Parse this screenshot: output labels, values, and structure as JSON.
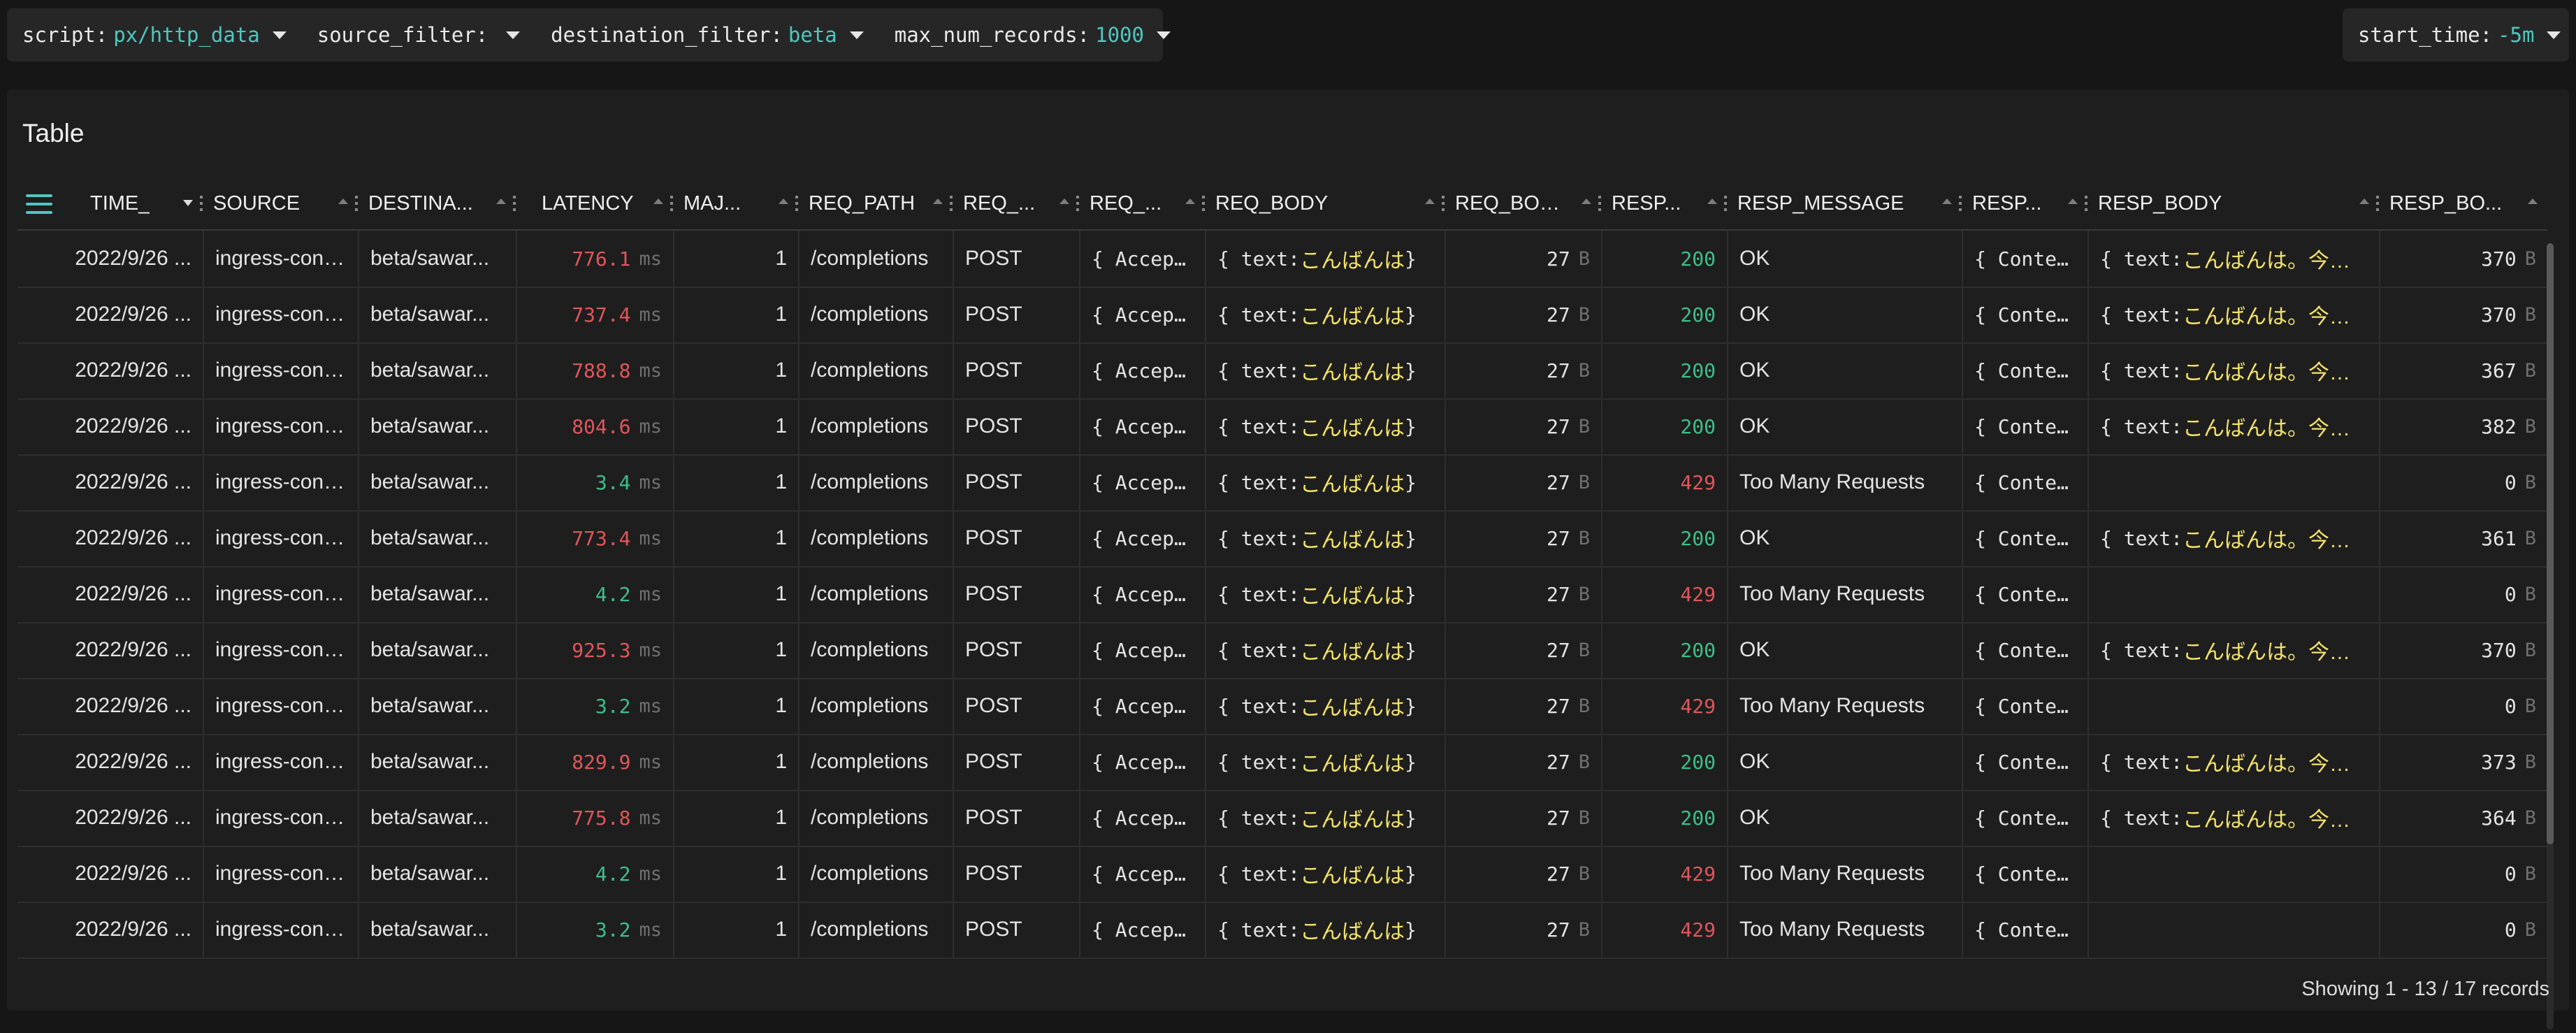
{
  "vars": {
    "script": {
      "key": "script:",
      "value": "px/http_data"
    },
    "source_filter": {
      "key": "source_filter:",
      "value": ""
    },
    "destination_filter": {
      "key": "destination_filter:",
      "value": "beta"
    },
    "max_num_records": {
      "key": "max_num_records:",
      "value": "1000"
    },
    "start_time": {
      "key": "start_time:",
      "value": "-5m"
    }
  },
  "panel": {
    "title": "Table",
    "footer": "Showing 1 - 13 / 17 records"
  },
  "columns": [
    "TIME_",
    "SOURCE",
    "DESTINA...",
    "LATENCY",
    "MAJ...",
    "REQ_PATH",
    "REQ_...",
    "REQ_...",
    "REQ_BODY",
    "REQ_BOD...",
    "RESP...",
    "RESP_MESSAGE",
    "RESP...",
    "RESP_BODY",
    "RESP_BO..."
  ],
  "units": {
    "ms": "ms",
    "bytes": "B"
  },
  "json": {
    "open": "{ text: ",
    "close": " }"
  },
  "rows": [
    {
      "time": "2022/9/26 ...",
      "source": "ingress-cont...",
      "dest": "beta/sawar...",
      "latency": "776.1",
      "lat_level": "high",
      "major": "1",
      "path": "/completions",
      "method": "POST",
      "req_headers": "{ Accep...",
      "req_body_text": "こんばんは",
      "req_body_size": "27",
      "status": "200",
      "message": "OK",
      "resp_headers": "{ Conte...",
      "resp_body_text": "こんばんは。今日...",
      "resp_body_size": "370"
    },
    {
      "time": "2022/9/26 ...",
      "source": "ingress-cont...",
      "dest": "beta/sawar...",
      "latency": "737.4",
      "lat_level": "high",
      "major": "1",
      "path": "/completions",
      "method": "POST",
      "req_headers": "{ Accep...",
      "req_body_text": "こんばんは",
      "req_body_size": "27",
      "status": "200",
      "message": "OK",
      "resp_headers": "{ Conte...",
      "resp_body_text": "こんばんは。今日...",
      "resp_body_size": "370"
    },
    {
      "time": "2022/9/26 ...",
      "source": "ingress-cont...",
      "dest": "beta/sawar...",
      "latency": "788.8",
      "lat_level": "high",
      "major": "1",
      "path": "/completions",
      "method": "POST",
      "req_headers": "{ Accep...",
      "req_body_text": "こんばんは",
      "req_body_size": "27",
      "status": "200",
      "message": "OK",
      "resp_headers": "{ Conte...",
      "resp_body_text": "こんばんは。今日...",
      "resp_body_size": "367"
    },
    {
      "time": "2022/9/26 ...",
      "source": "ingress-cont...",
      "dest": "beta/sawar...",
      "latency": "804.6",
      "lat_level": "high",
      "major": "1",
      "path": "/completions",
      "method": "POST",
      "req_headers": "{ Accep...",
      "req_body_text": "こんばんは",
      "req_body_size": "27",
      "status": "200",
      "message": "OK",
      "resp_headers": "{ Conte...",
      "resp_body_text": "こんばんは。今日...",
      "resp_body_size": "382"
    },
    {
      "time": "2022/9/26 ...",
      "source": "ingress-cont...",
      "dest": "beta/sawar...",
      "latency": "3.4",
      "lat_level": "low",
      "major": "1",
      "path": "/completions",
      "method": "POST",
      "req_headers": "{ Accep...",
      "req_body_text": "こんばんは",
      "req_body_size": "27",
      "status": "429",
      "message": "Too Many Requests",
      "resp_headers": "{ Conte...",
      "resp_body_text": "",
      "resp_body_size": "0"
    },
    {
      "time": "2022/9/26 ...",
      "source": "ingress-cont...",
      "dest": "beta/sawar...",
      "latency": "773.4",
      "lat_level": "high",
      "major": "1",
      "path": "/completions",
      "method": "POST",
      "req_headers": "{ Accep...",
      "req_body_text": "こんばんは",
      "req_body_size": "27",
      "status": "200",
      "message": "OK",
      "resp_headers": "{ Conte...",
      "resp_body_text": "こんばんは。今日...",
      "resp_body_size": "361"
    },
    {
      "time": "2022/9/26 ...",
      "source": "ingress-cont...",
      "dest": "beta/sawar...",
      "latency": "4.2",
      "lat_level": "low",
      "major": "1",
      "path": "/completions",
      "method": "POST",
      "req_headers": "{ Accep...",
      "req_body_text": "こんばんは",
      "req_body_size": "27",
      "status": "429",
      "message": "Too Many Requests",
      "resp_headers": "{ Conte...",
      "resp_body_text": "",
      "resp_body_size": "0"
    },
    {
      "time": "2022/9/26 ...",
      "source": "ingress-cont...",
      "dest": "beta/sawar...",
      "latency": "925.3",
      "lat_level": "high",
      "major": "1",
      "path": "/completions",
      "method": "POST",
      "req_headers": "{ Accep...",
      "req_body_text": "こんばんは",
      "req_body_size": "27",
      "status": "200",
      "message": "OK",
      "resp_headers": "{ Conte...",
      "resp_body_text": "こんばんは。今日...",
      "resp_body_size": "370"
    },
    {
      "time": "2022/9/26 ...",
      "source": "ingress-cont...",
      "dest": "beta/sawar...",
      "latency": "3.2",
      "lat_level": "low",
      "major": "1",
      "path": "/completions",
      "method": "POST",
      "req_headers": "{ Accep...",
      "req_body_text": "こんばんは",
      "req_body_size": "27",
      "status": "429",
      "message": "Too Many Requests",
      "resp_headers": "{ Conte...",
      "resp_body_text": "",
      "resp_body_size": "0"
    },
    {
      "time": "2022/9/26 ...",
      "source": "ingress-cont...",
      "dest": "beta/sawar...",
      "latency": "829.9",
      "lat_level": "high",
      "major": "1",
      "path": "/completions",
      "method": "POST",
      "req_headers": "{ Accep...",
      "req_body_text": "こんばんは",
      "req_body_size": "27",
      "status": "200",
      "message": "OK",
      "resp_headers": "{ Conte...",
      "resp_body_text": "こんばんは。今日...",
      "resp_body_size": "373"
    },
    {
      "time": "2022/9/26 ...",
      "source": "ingress-cont...",
      "dest": "beta/sawar...",
      "latency": "775.8",
      "lat_level": "high",
      "major": "1",
      "path": "/completions",
      "method": "POST",
      "req_headers": "{ Accep...",
      "req_body_text": "こんばんは",
      "req_body_size": "27",
      "status": "200",
      "message": "OK",
      "resp_headers": "{ Conte...",
      "resp_body_text": "こんばんは。今日...",
      "resp_body_size": "364"
    },
    {
      "time": "2022/9/26 ...",
      "source": "ingress-cont...",
      "dest": "beta/sawar...",
      "latency": "4.2",
      "lat_level": "low",
      "major": "1",
      "path": "/completions",
      "method": "POST",
      "req_headers": "{ Accep...",
      "req_body_text": "こんばんは",
      "req_body_size": "27",
      "status": "429",
      "message": "Too Many Requests",
      "resp_headers": "{ Conte...",
      "resp_body_text": "",
      "resp_body_size": "0"
    },
    {
      "time": "2022/9/26 ...",
      "source": "ingress-cont...",
      "dest": "beta/sawar...",
      "latency": "3.2",
      "lat_level": "low",
      "major": "1",
      "path": "/completions",
      "method": "POST",
      "req_headers": "{ Accep...",
      "req_body_text": "こんばんは",
      "req_body_size": "27",
      "status": "429",
      "message": "Too Many Requests",
      "resp_headers": "{ Conte...",
      "resp_body_text": "",
      "resp_body_size": "0"
    }
  ]
}
